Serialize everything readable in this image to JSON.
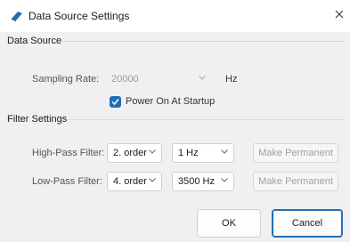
{
  "window": {
    "title": "Data Source Settings",
    "close_icon": "close-icon",
    "app_icon": "app-icon"
  },
  "data_source": {
    "group_label": "Data Source",
    "sampling_rate_label": "Sampling Rate:",
    "sampling_rate_value": "20000",
    "sampling_rate_unit": "Hz",
    "power_on_label": "Power On At Startup",
    "power_on_checked": true
  },
  "filter_settings": {
    "group_label": "Filter Settings",
    "high_pass": {
      "label": "High-Pass Filter:",
      "order": "2. order",
      "frequency": "1 Hz",
      "button_label": "Make Permanent"
    },
    "low_pass": {
      "label": "Low-Pass Filter:",
      "order": "4. order",
      "frequency": "3500 Hz",
      "button_label": "Make Permanent"
    }
  },
  "footer": {
    "ok_label": "OK",
    "cancel_label": "Cancel"
  },
  "colors": {
    "accent": "#1f6fb5",
    "dialog_bg": "#f0f0f0"
  }
}
